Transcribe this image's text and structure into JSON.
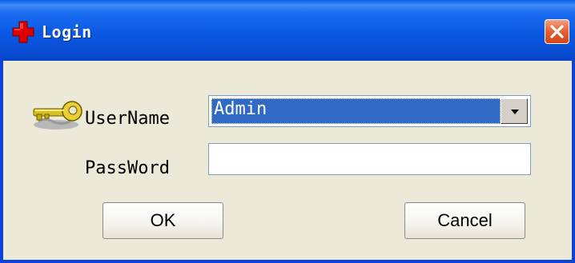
{
  "window": {
    "title": "Login",
    "icon": "red-cross-icon",
    "close_icon": "close-icon"
  },
  "form": {
    "username_label": "UserName",
    "username_value": "Admin",
    "password_label": "PassWord",
    "password_value": ""
  },
  "buttons": {
    "ok_label": "OK",
    "cancel_label": "Cancel"
  },
  "colors": {
    "titlebar": "#0a58e2",
    "close": "#e8643a",
    "selection": "#316ac5",
    "dialog_bg": "#ece9d8"
  }
}
